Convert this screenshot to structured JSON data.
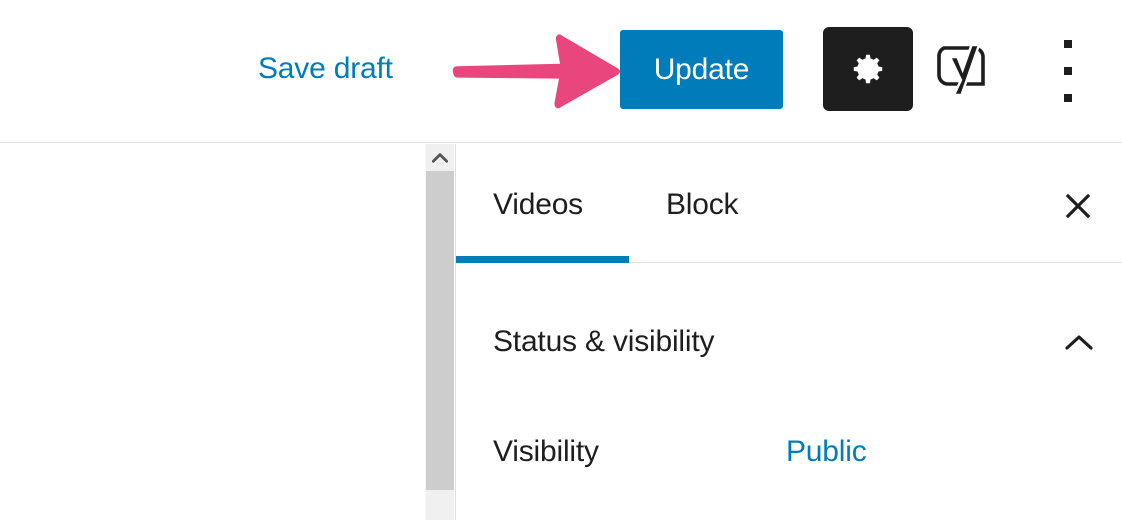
{
  "header": {
    "save_draft_label": "Save draft",
    "update_label": "Update",
    "settings_icon": "gear-icon",
    "yoast_icon": "yoast-logo-icon",
    "more_menu_icon": "vertical-ellipsis-icon",
    "accent_blue": "#007cba",
    "dark_button_bg": "#1e1e1e"
  },
  "annotation": {
    "arrow_icon": "right-arrow-annotation",
    "arrow_color": "#E8467C"
  },
  "scrollbar": {
    "up_arrow_icon": "chevron-up-icon",
    "track_color": "#f0f0f0",
    "thumb_color": "#cdcdcd"
  },
  "sidebar": {
    "tabs": [
      {
        "label": "Videos",
        "active": true
      },
      {
        "label": "Block",
        "active": false
      }
    ],
    "close_icon": "close-x-icon",
    "sections": [
      {
        "title": "Status & visibility",
        "toggle_icon": "chevron-up-icon",
        "expanded": true,
        "rows": [
          {
            "label": "Visibility",
            "value": "Public"
          }
        ]
      }
    ]
  }
}
